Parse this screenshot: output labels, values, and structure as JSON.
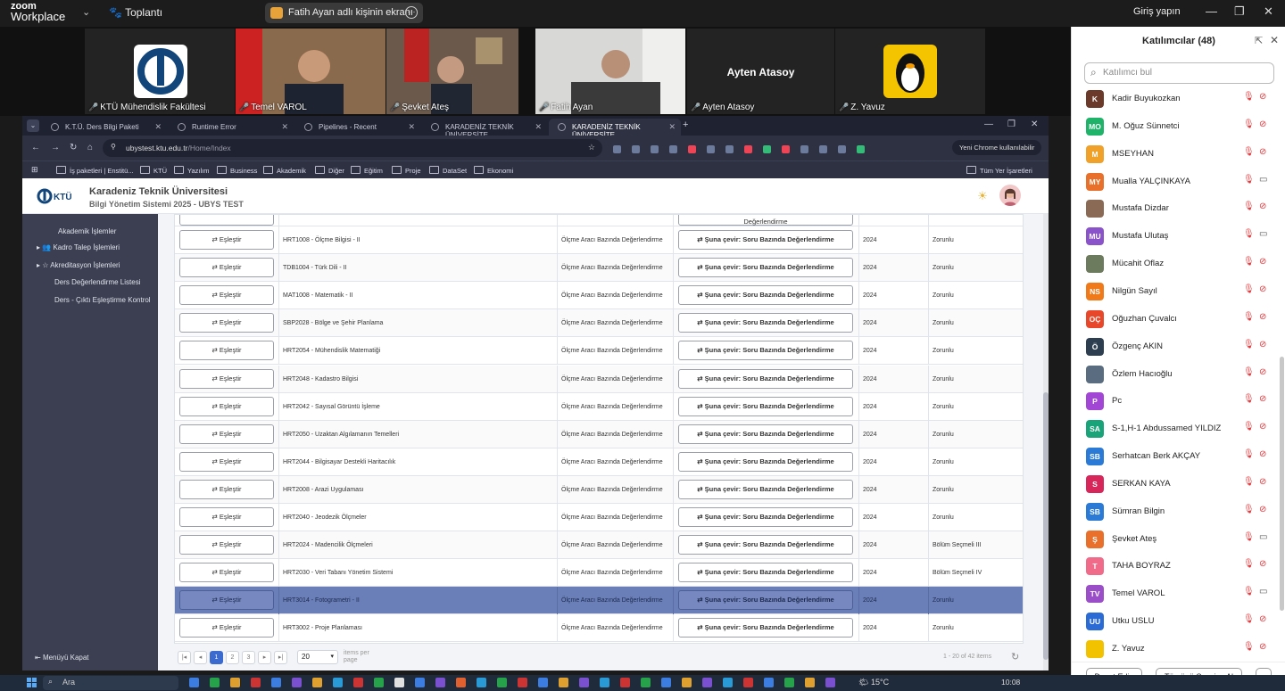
{
  "zoom": {
    "app_title_top": "zoom",
    "app_title_bottom": "Workplace",
    "meeting_label": "Toplantı",
    "screen_share_label": "Fatih Ayan adlı kişinin ekranı",
    "login_label": "Giriş yapın",
    "icons": [
      "chevron-down-icon",
      "paw-icon",
      "more-icon",
      "minimize-icon",
      "restore-icon",
      "close-icon"
    ]
  },
  "video_tiles": [
    {
      "name": "KTÜ Mühendislik Fakültesi",
      "muted": true
    },
    {
      "name": "Temel VAROL",
      "muted": true
    },
    {
      "name": "Şevket Ateş",
      "muted": true
    },
    {
      "name": "Fatih Ayan",
      "muted": false,
      "active": true
    },
    {
      "name": "Ayten Atasoy",
      "center_label": "Ayten Atasoy",
      "muted": true
    },
    {
      "name": "Z. Yavuz",
      "muted": true
    }
  ],
  "browser": {
    "tabs": [
      {
        "label": "K.T.Ü. Ders Bilgi Paketi"
      },
      {
        "label": "Runtime Error"
      },
      {
        "label": "Pipelines - Recent"
      },
      {
        "label": "KARADENİZ TEKNİK ÜNİVERSİTE"
      },
      {
        "label": "KARADENİZ TEKNİK ÜNİVERSİTE",
        "active": true
      }
    ],
    "url_host": "ubystest.ktu.edu.tr",
    "url_path": "/Home/Index",
    "chrome_user_label": "Yeni Chrome kullanılabilir",
    "bookmarks": [
      "İş paketleri | Enstitü...",
      "KTÜ",
      "Yazılım",
      "Business",
      "Akademik",
      "Diğer",
      "Eğitim",
      "Proje",
      "DataSet",
      "Ekonomi"
    ],
    "all_bookmarks_label": "Tüm Yer İşaretleri"
  },
  "site": {
    "logo_text": "KTÜ",
    "university_name": "Karadeniz Teknik Üniversitesi",
    "system_name": "Bilgi Yönetim Sistemi 2025 - UBYS TEST"
  },
  "side_menu": {
    "items": [
      "Akademik İşlemler",
      "Kadro Talep İşlemleri",
      "Akreditasyon İşlemleri",
      "Ders Değerlendirme Listesi",
      "Ders - Çıktı Eşleştirme Kontrol"
    ],
    "collapse_label": "Menüyü Kapat"
  },
  "grid": {
    "match_label": "Eşleştir",
    "top_partial_label": "Değerlendirme",
    "rows": [
      {
        "course": "HRT1008 - Ölçme Bilgisi - II",
        "method": "Ölçme Aracı Bazında Değerlendirme",
        "convert": "Şuna çevir: Soru Bazında Değerlendirme",
        "year": "2024",
        "type": "Zorunlu"
      },
      {
        "course": "TDB1004 - Türk Dili - II",
        "method": "Ölçme Aracı Bazında Değerlendirme",
        "convert": "Şuna çevir: Soru Bazında Değerlendirme",
        "year": "2024",
        "type": "Zorunlu"
      },
      {
        "course": "MAT1008 - Matematik - II",
        "method": "Ölçme Aracı Bazında Değerlendirme",
        "convert": "Şuna çevir: Soru Bazında Değerlendirme",
        "year": "2024",
        "type": "Zorunlu"
      },
      {
        "course": "SBP2028 - Bölge ve Şehir Planlama",
        "method": "Ölçme Aracı Bazında Değerlendirme",
        "convert": "Şuna çevir: Soru Bazında Değerlendirme",
        "year": "2024",
        "type": "Zorunlu"
      },
      {
        "course": "HRT2054 - Mühendislik Matematiği",
        "method": "Ölçme Aracı Bazında Değerlendirme",
        "convert": "Şuna çevir: Soru Bazında Değerlendirme",
        "year": "2024",
        "type": "Zorunlu"
      },
      {
        "course": "HRT2048 - Kadastro Bilgisi",
        "method": "Ölçme Aracı Bazında Değerlendirme",
        "convert": "Şuna çevir: Soru Bazında Değerlendirme",
        "year": "2024",
        "type": "Zorunlu"
      },
      {
        "course": "HRT2042 - Sayısal Görüntü İşleme",
        "method": "Ölçme Aracı Bazında Değerlendirme",
        "convert": "Şuna çevir: Soru Bazında Değerlendirme",
        "year": "2024",
        "type": "Zorunlu"
      },
      {
        "course": "HRT2050 - Uzaktan Algılamanın Temelleri",
        "method": "Ölçme Aracı Bazında Değerlendirme",
        "convert": "Şuna çevir: Soru Bazında Değerlendirme",
        "year": "2024",
        "type": "Zorunlu"
      },
      {
        "course": "HRT2044 - Bilgisayar Destekli Haritacılık",
        "method": "Ölçme Aracı Bazında Değerlendirme",
        "convert": "Şuna çevir: Soru Bazında Değerlendirme",
        "year": "2024",
        "type": "Zorunlu"
      },
      {
        "course": "HRT2008 - Arazi Uygulaması",
        "method": "Ölçme Aracı Bazında Değerlendirme",
        "convert": "Şuna çevir: Soru Bazında Değerlendirme",
        "year": "2024",
        "type": "Zorunlu"
      },
      {
        "course": "HRT2040 - Jeodezik Ölçmeler",
        "method": "Ölçme Aracı Bazında Değerlendirme",
        "convert": "Şuna çevir: Soru Bazında Değerlendirme",
        "year": "2024",
        "type": "Zorunlu"
      },
      {
        "course": "HRT2024 - Madencilik Ölçmeleri",
        "method": "Ölçme Aracı Bazında Değerlendirme",
        "convert": "Şuna çevir: Soru Bazında Değerlendirme",
        "year": "2024",
        "type": "Bölüm Seçmeli III"
      },
      {
        "course": "HRT2030 - Veri Tabanı Yönetim Sistemi",
        "method": "Ölçme Aracı Bazında Değerlendirme",
        "convert": "Şuna çevir: Soru Bazında Değerlendirme",
        "year": "2024",
        "type": "Bölüm Seçmeli IV"
      },
      {
        "course": "HRT3014 - Fotogrametri - II",
        "method": "Ölçme Aracı Bazında Değerlendirme",
        "convert": "Şuna çevir: Soru Bazında Değerlendirme",
        "year": "2024",
        "type": "Zorunlu",
        "selected": true
      },
      {
        "course": "HRT3002 - Proje Planlaması",
        "method": "Ölçme Aracı Bazında Değerlendirme",
        "convert": "Şuna çevir: Soru Bazında Değerlendirme",
        "year": "2024",
        "type": "Zorunlu"
      }
    ]
  },
  "pager": {
    "pages": [
      "1",
      "2",
      "3"
    ],
    "current_page": "1",
    "page_size": "20",
    "items_per_page_label": "items per page",
    "info": "1 - 20 of 42 items"
  },
  "participants": {
    "title": "Katılımcılar (48)",
    "search_placeholder": "Katılımcı bul",
    "list": [
      {
        "initials": "K",
        "name": "Kadir Buyukozkan",
        "color": "#6b3a2a",
        "cam_on": false
      },
      {
        "initials": "MO",
        "name": "M. Oğuz Sünnetci",
        "color": "#1fb36a",
        "cam_on": false
      },
      {
        "initials": "M",
        "name": "MSEYHAN",
        "color": "#f0a12a",
        "cam_on": false
      },
      {
        "initials": "MY",
        "name": "Mualla YALÇINKAYA",
        "color": "#e8702a",
        "cam_on": true
      },
      {
        "initials": "",
        "name": "Mustafa Dizdar",
        "color": "#8a6a55",
        "cam_on": false
      },
      {
        "initials": "MU",
        "name": "Mustafa Ulutaş",
        "color": "#8b53c9",
        "cam_on": true
      },
      {
        "initials": "",
        "name": "Mücahit Oflaz",
        "color": "#6c7a5e",
        "cam_on": false
      },
      {
        "initials": "NS",
        "name": "Nilgün Sayıl",
        "color": "#f07a1a",
        "cam_on": false
      },
      {
        "initials": "OÇ",
        "name": "Oğuzhan Çuvalcı",
        "color": "#e8472a",
        "cam_on": false
      },
      {
        "initials": "Ö",
        "name": "Özgenç AKIN",
        "color": "#2c3e50",
        "cam_on": false
      },
      {
        "initials": "",
        "name": "Özlem Hacıoğlu",
        "color": "#5a6c80",
        "cam_on": false
      },
      {
        "initials": "P",
        "name": "Pc",
        "color": "#a246d6",
        "cam_on": false
      },
      {
        "initials": "SA",
        "name": "S-1,H-1 Abdussamed YILDIZ",
        "color": "#1aa378",
        "cam_on": false
      },
      {
        "initials": "SB",
        "name": "Serhatcan Berk AKÇAY",
        "color": "#2b7bd6",
        "cam_on": false
      },
      {
        "initials": "S",
        "name": "SERKAN KAYA",
        "color": "#d6265a",
        "cam_on": false
      },
      {
        "initials": "SB",
        "name": "Sümran Bilgin",
        "color": "#2b7bd6",
        "cam_on": false
      },
      {
        "initials": "Ş",
        "name": "Şevket Ateş",
        "color": "#e8702a",
        "cam_on": true
      },
      {
        "initials": "T",
        "name": "TAHA BOYRAZ",
        "color": "#f06a8a",
        "cam_on": false
      },
      {
        "initials": "TV",
        "name": "Temel VAROL",
        "color": "#9a4fc9",
        "cam_on": true
      },
      {
        "initials": "UU",
        "name": "Utku USLU",
        "color": "#2b6bd6",
        "cam_on": false
      },
      {
        "initials": "",
        "name": "Z. Yavuz",
        "color": "#f2c200",
        "cam_on": false
      }
    ],
    "invite_label": "Davet Edin",
    "mute_all_label": "Tümünü Sessize Al",
    "more_label": "···"
  },
  "taskbar": {
    "search_label": "Ara",
    "weather": "15°C",
    "time": "10:08"
  }
}
